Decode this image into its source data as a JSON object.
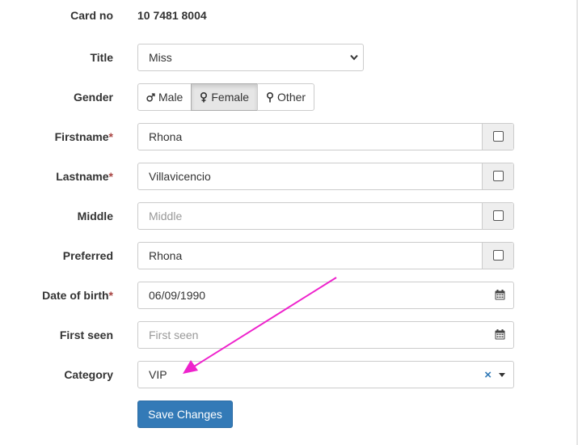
{
  "form": {
    "card_no": {
      "label": "Card no",
      "value": "10 7481 8004"
    },
    "title": {
      "label": "Title",
      "selected": "Miss"
    },
    "gender": {
      "label": "Gender",
      "options": [
        "Male",
        "Female",
        "Other"
      ],
      "selected": "Female"
    },
    "firstname": {
      "label": "Firstname",
      "required_mark": "*",
      "value": "Rhona",
      "checked": false
    },
    "lastname": {
      "label": "Lastname",
      "required_mark": "*",
      "value": "Villavicencio",
      "checked": false
    },
    "middle": {
      "label": "Middle",
      "placeholder": "Middle",
      "value": "",
      "checked": false
    },
    "preferred": {
      "label": "Preferred",
      "value": "Rhona",
      "checked": false
    },
    "dob": {
      "label": "Date of birth",
      "required_mark": "*",
      "value": "06/09/1990"
    },
    "first_seen": {
      "label": "First seen",
      "placeholder": "First seen",
      "value": ""
    },
    "category": {
      "label": "Category",
      "value": "VIP",
      "clear_icon": "×"
    },
    "save_label": "Save Changes"
  },
  "annotation": {
    "color": "#ee22cc",
    "icon": "arrow-pointer"
  },
  "colors": {
    "primary": "#337ab7",
    "required": "#a94442"
  }
}
